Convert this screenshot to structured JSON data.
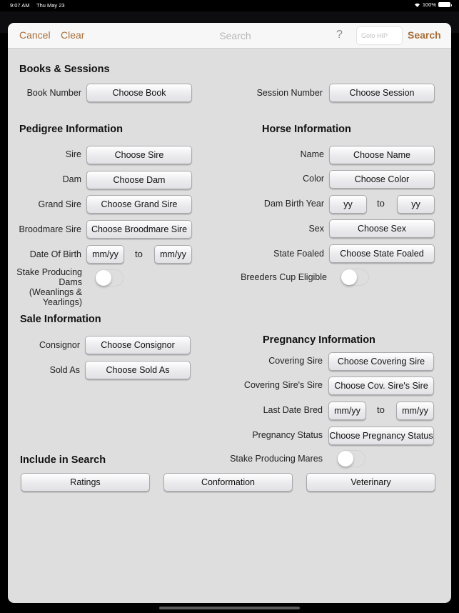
{
  "status_bar": {
    "time": "9:07 AM",
    "date": "Thu May 23",
    "battery": "100%"
  },
  "nav": {
    "cancel_label": "Cancel",
    "clear_label": "Clear",
    "title": "Search",
    "help_icon": "?",
    "goto_placeholder": "Goto HIP",
    "search_label": "Search",
    "accent_color": "#a86f3b"
  },
  "books_sessions": {
    "heading": "Books & Sessions",
    "book_label": "Book Number",
    "book_button": "Choose Book",
    "session_label": "Session Number",
    "session_button": "Choose Session"
  },
  "pedigree": {
    "heading": "Pedigree Information",
    "sire_label": "Sire",
    "sire_button": "Choose Sire",
    "dam_label": "Dam",
    "dam_button": "Choose Dam",
    "grand_sire_label": "Grand Sire",
    "grand_sire_button": "Choose Grand Sire",
    "broodmare_sire_label": "Broodmare Sire",
    "broodmare_sire_button": "Choose Broodmare Sire",
    "dob_label": "Date Of Birth",
    "dob_from": "mm/yy",
    "dob_to_word": "to",
    "dob_to": "mm/yy",
    "stake_dams_label_1": "Stake Producing",
    "stake_dams_label_2": "Dams",
    "stake_dams_label_3": "(Weanlings &",
    "stake_dams_label_4": "Yearlings)",
    "stake_dams_on": false
  },
  "horse": {
    "heading": "Horse Information",
    "name_label": "Name",
    "name_button": "Choose Name",
    "color_label": "Color",
    "color_button": "Choose Color",
    "dam_birth_year_label": "Dam Birth Year",
    "dam_birth_from": "yy",
    "dam_birth_to_word": "to",
    "dam_birth_to": "yy",
    "sex_label": "Sex",
    "sex_button": "Choose Sex",
    "state_foaled_label": "State Foaled",
    "state_foaled_button": "Choose State Foaled",
    "breeders_cup_label": "Breeders Cup Eligible",
    "breeders_cup_on": false
  },
  "sale": {
    "heading": "Sale Information",
    "consignor_label": "Consignor",
    "consignor_button": "Choose Consignor",
    "sold_as_label": "Sold As",
    "sold_as_button": "Choose Sold As"
  },
  "pregnancy": {
    "heading": "Pregnancy Information",
    "covering_sire_label": "Covering Sire",
    "covering_sire_button": "Choose Covering Sire",
    "cov_sires_sire_label": "Covering Sire's Sire",
    "cov_sires_sire_button": "Choose Cov. Sire's Sire",
    "last_bred_label": "Last Date Bred",
    "last_bred_from": "mm/yy",
    "last_bred_to_word": "to",
    "last_bred_to": "mm/yy",
    "status_label": "Pregnancy Status",
    "status_button": "Choose Pregnancy Status",
    "stake_mares_label": "Stake Producing Mares",
    "stake_mares_on": false
  },
  "include": {
    "heading": "Include in Search",
    "buttons": [
      "Ratings",
      "Conformation",
      "Veterinary"
    ]
  }
}
